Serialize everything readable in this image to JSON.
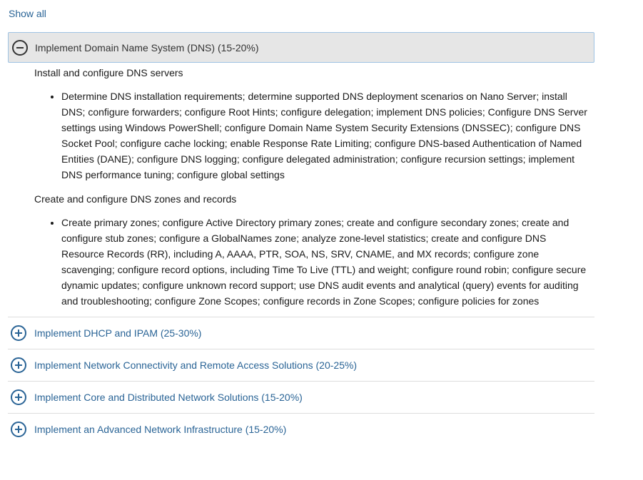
{
  "show_all": "Show all",
  "sections": {
    "open": {
      "title": "Implement Domain Name System (DNS) (15-20%)",
      "subsections": [
        {
          "heading": "Install and configure DNS servers",
          "bullet": "Determine DNS installation requirements; determine supported DNS deployment scenarios on Nano Server; install DNS; configure forwarders; configure Root Hints; configure delegation; implement DNS policies; Configure DNS Server settings using Windows PowerShell; configure Domain Name System Security Extensions (DNSSEC); configure DNS Socket Pool; configure cache locking; enable Response Rate Limiting; configure DNS-based Authentication of Named Entities (DANE); configure DNS logging; configure delegated administration; configure recursion settings; implement DNS performance tuning; configure global settings"
        },
        {
          "heading": "Create and configure DNS zones and records",
          "bullet": "Create primary zones; configure Active Directory primary zones; create and configure secondary zones; create and configure stub zones; configure a GlobalNames zone; analyze zone-level statistics; create and configure DNS Resource Records (RR), including A, AAAA, PTR, SOA, NS, SRV, CNAME, and MX records; configure zone scavenging; configure record options, including Time To Live (TTL) and weight; configure round robin; configure secure dynamic updates; configure unknown record support; use DNS audit events and analytical (query) events for auditing and troubleshooting; configure Zone Scopes; configure records in Zone Scopes; configure policies for zones"
        }
      ]
    },
    "closed": [
      {
        "title": "Implement DHCP and IPAM (25-30%)"
      },
      {
        "title": "Implement Network Connectivity and Remote Access Solutions (20-25%)"
      },
      {
        "title": "Implement Core and Distributed Network Solutions (15-20%)"
      },
      {
        "title": "Implement an Advanced Network Infrastructure (15-20%)"
      }
    ]
  },
  "colors": {
    "link": "#2a6496",
    "header_bg": "#e6e6e6",
    "header_border": "#9fc3e3"
  },
  "icons": {
    "expanded": "minus-circle-icon",
    "collapsed": "plus-circle-icon"
  }
}
